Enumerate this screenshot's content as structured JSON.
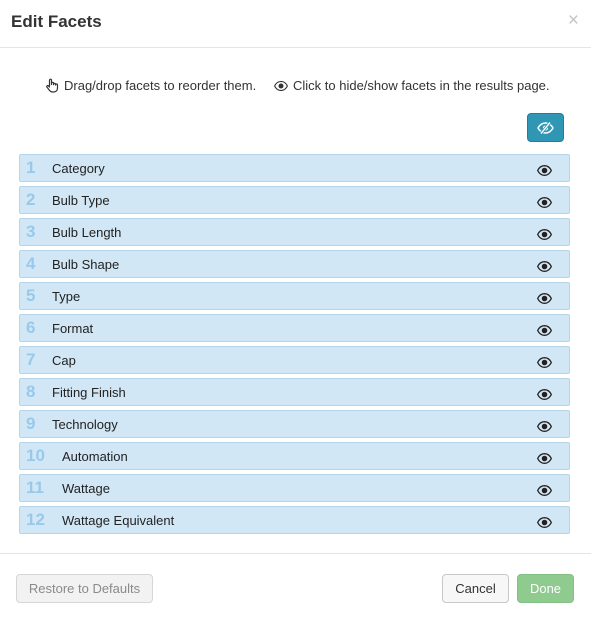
{
  "dialog": {
    "title": "Edit Facets",
    "close_glyph": "×"
  },
  "hints": {
    "drag": "Drag/drop facets to reorder them.",
    "visibility": "Click to hide/show facets in the results page.",
    "drag_icon": "hand-pointer-icon",
    "visibility_icon": "eye-icon"
  },
  "toolbar": {
    "toggle_all_icon": "eye-slash-icon"
  },
  "facets": [
    {
      "num": "1",
      "label": "Category",
      "visible": true
    },
    {
      "num": "2",
      "label": "Bulb Type",
      "visible": true
    },
    {
      "num": "3",
      "label": "Bulb Length",
      "visible": true
    },
    {
      "num": "4",
      "label": "Bulb Shape",
      "visible": true
    },
    {
      "num": "5",
      "label": "Type",
      "visible": true
    },
    {
      "num": "6",
      "label": "Format",
      "visible": true
    },
    {
      "num": "7",
      "label": "Cap",
      "visible": true
    },
    {
      "num": "8",
      "label": "Fitting Finish",
      "visible": true
    },
    {
      "num": "9",
      "label": "Technology",
      "visible": true
    },
    {
      "num": "10",
      "label": "Automation",
      "visible": true
    },
    {
      "num": "11",
      "label": "Wattage",
      "visible": true
    },
    {
      "num": "12",
      "label": "Wattage Equivalent",
      "visible": true
    }
  ],
  "footer": {
    "restore_label": "Restore to Defaults",
    "cancel_label": "Cancel",
    "done_label": "Done"
  },
  "colors": {
    "row_bg": "#d2e7f6",
    "number": "#99c9ea",
    "toggle_button": "#2f96b4",
    "done_button": "#8fcb8f"
  }
}
